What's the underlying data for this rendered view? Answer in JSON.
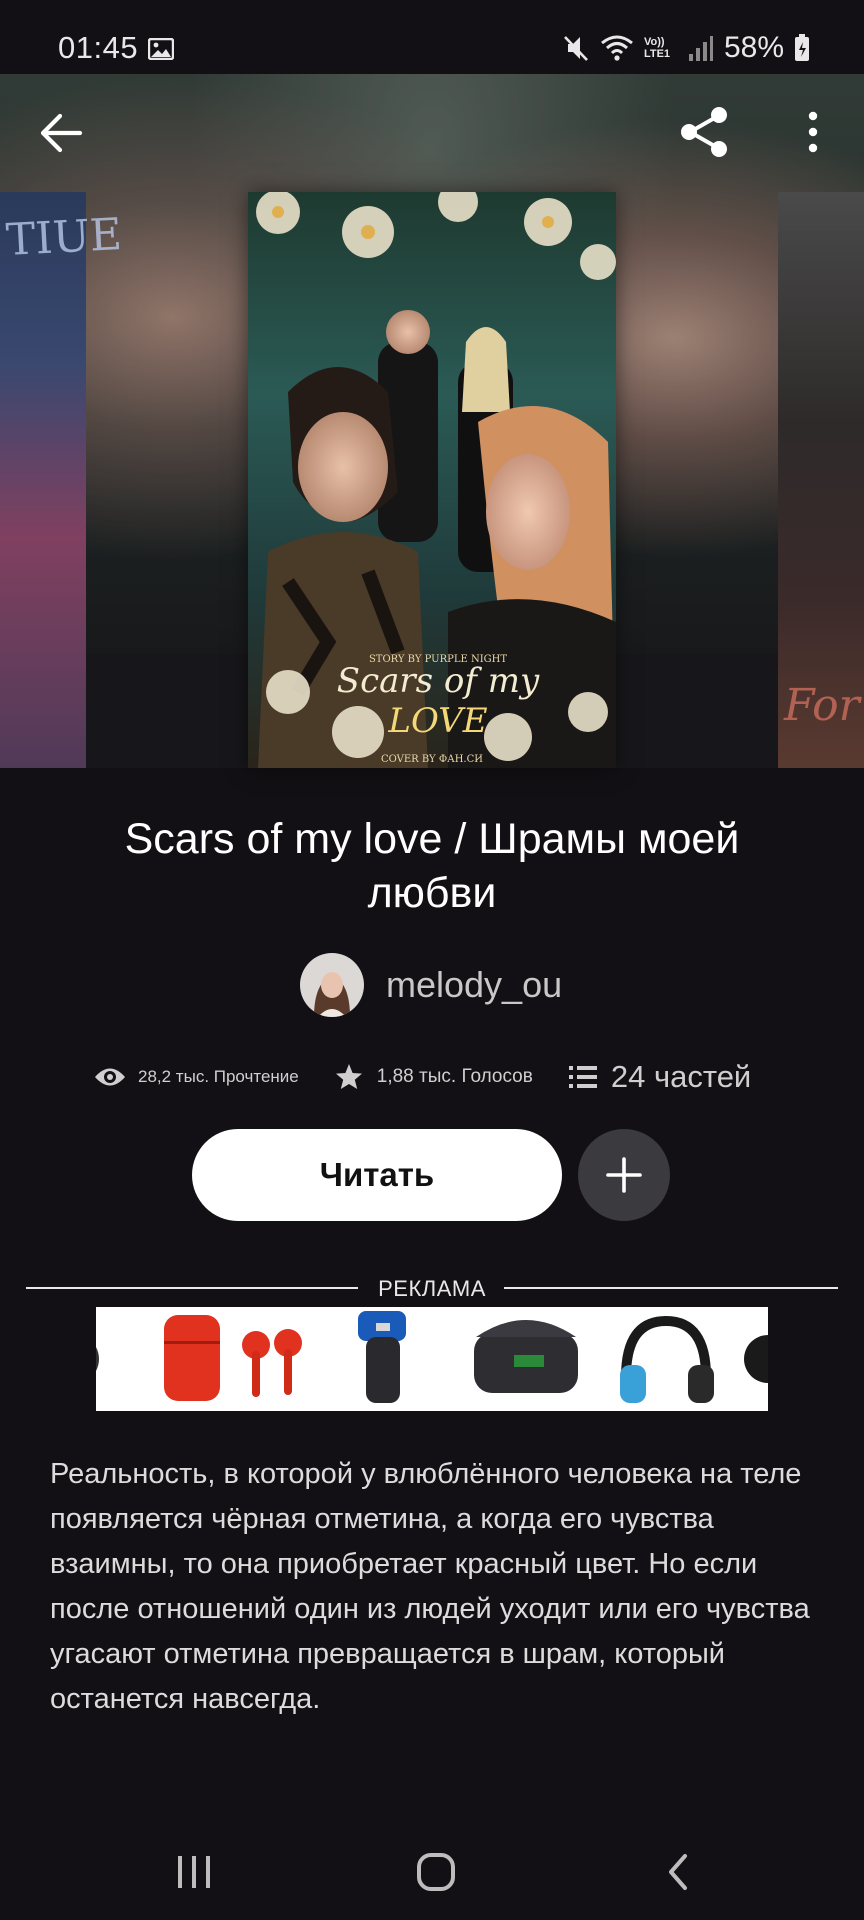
{
  "status_bar": {
    "time": "01:45",
    "battery": "58%",
    "network_label": "Vo)) LTE1",
    "icons": [
      "gallery-icon",
      "mute-icon",
      "wifi-icon",
      "signal-icon",
      "battery-icon"
    ]
  },
  "toolbar": {
    "back_icon": "arrow-left-icon",
    "share_icon": "share-icon",
    "more_icon": "more-vertical-icon"
  },
  "cover": {
    "title_art": "Scars of my",
    "title_art_line2": "LOVE",
    "credit_top": "STORY BY PURPLE NIGHT",
    "credit_bottom": "COVER BY ФАН.СИ"
  },
  "side_covers": {
    "left_text": "TIUE",
    "right_text": "For"
  },
  "story": {
    "title": "Scars of my love / Шрамы моей любви",
    "author": "melody_ou",
    "reads": "28,2 тыс. Прочтение",
    "votes": "1,88 тыс. Голосов",
    "parts": "24 частей"
  },
  "actions": {
    "read_label": "Читать",
    "add_icon": "plus-icon"
  },
  "ad": {
    "label": "РЕКЛАМА"
  },
  "description": "Реальность, в которой у влюблённого человека на теле появляется чёрная отметина, а когда его чувства взаимны, то она приобретает красный цвет. Но если после отношений один из людей уходит или его чувства угасают отметина превращается в шрам, который останется навсегда.",
  "navbar": {
    "icons": [
      "recent-apps-icon",
      "home-icon",
      "back-icon"
    ]
  },
  "colors": {
    "background": "#121014",
    "read_button": "#ffffff",
    "add_button": "#3b3a3e"
  }
}
